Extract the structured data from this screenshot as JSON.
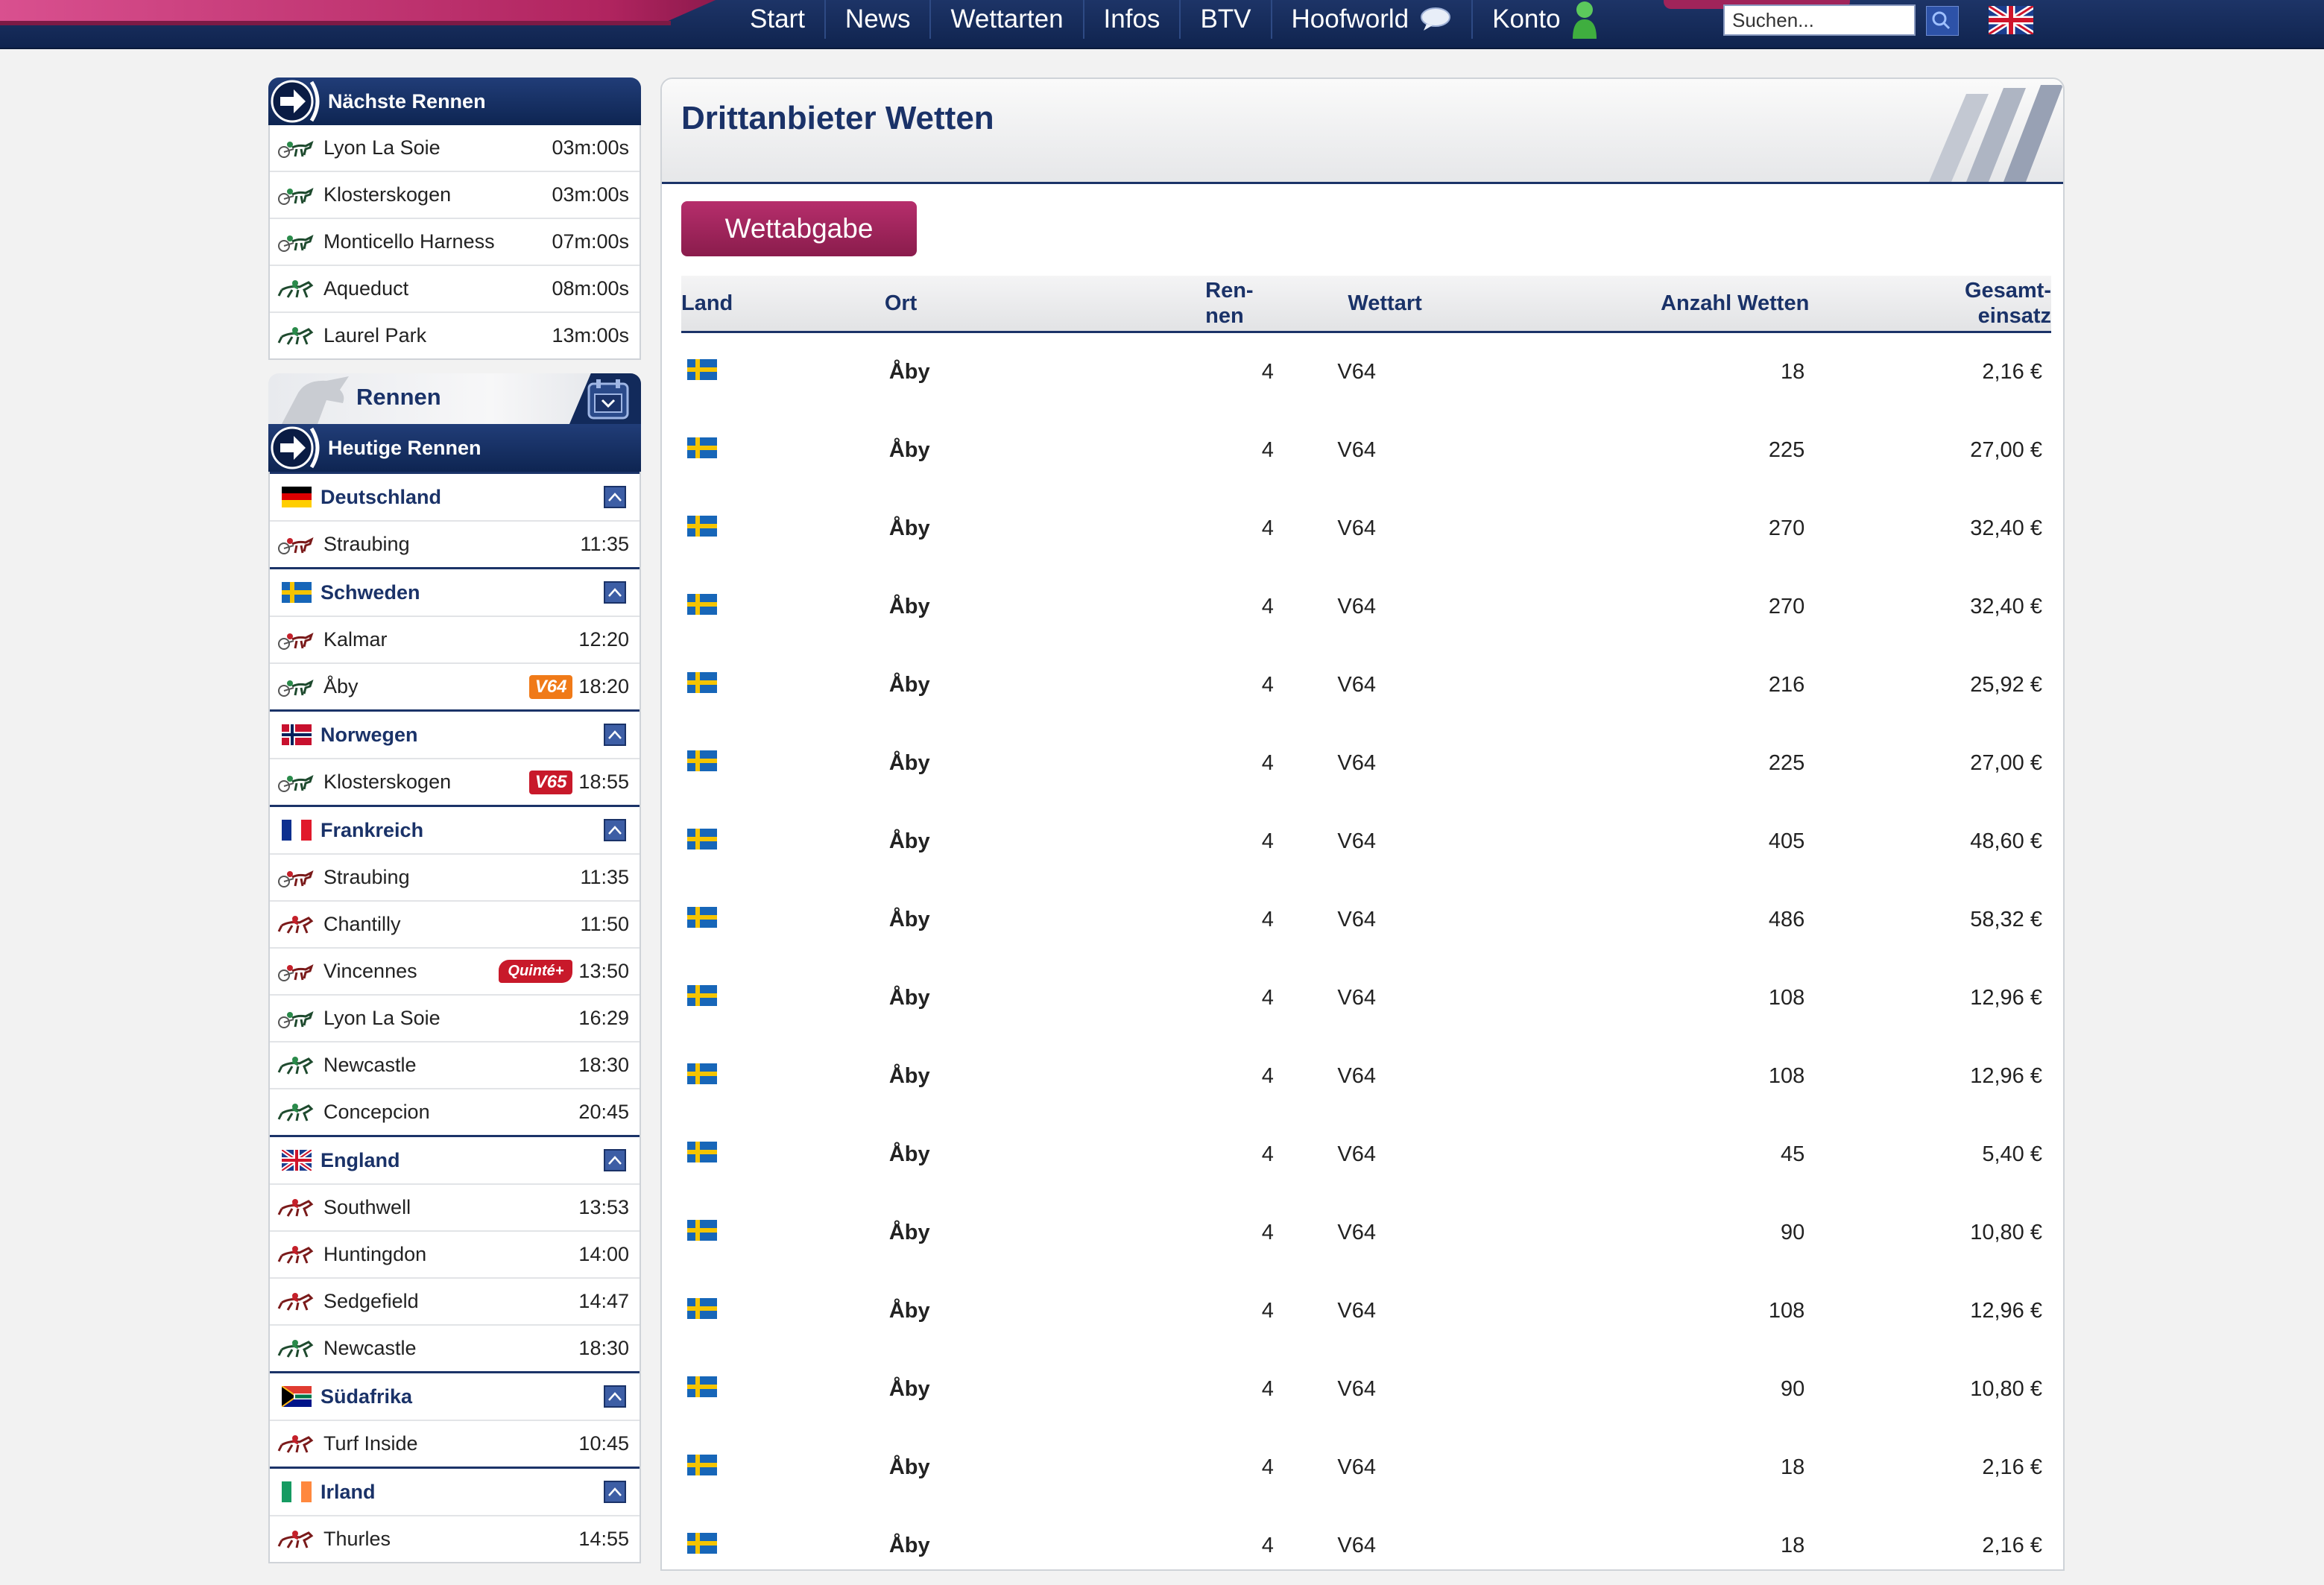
{
  "nav": {
    "items": [
      "Start",
      "News",
      "Wettarten",
      "Infos",
      "BTV",
      "Hoofworld",
      "Konto"
    ],
    "search_placeholder": "Suchen...",
    "icons": {
      "hoofworld": "chat-bubble-icon",
      "konto": "user-icon",
      "language": "uk-flag-icon"
    }
  },
  "sidebar": {
    "next_title": "Nächste Rennen",
    "next_races": [
      {
        "name": "Lyon La Soie",
        "time": "03m:00s",
        "horse": "trotter"
      },
      {
        "name": "Klosterskogen",
        "time": "03m:00s",
        "horse": "trotter"
      },
      {
        "name": "Monticello Harness",
        "time": "07m:00s",
        "horse": "trotter"
      },
      {
        "name": "Aqueduct",
        "time": "08m:00s",
        "horse": "gallop"
      },
      {
        "name": "Laurel Park",
        "time": "13m:00s",
        "horse": "gallop"
      }
    ],
    "rennen_title": "Rennen",
    "today_title": "Heutige Rennen",
    "countries": [
      {
        "name": "Deutschland",
        "flag": "de",
        "races": [
          {
            "name": "Straubing",
            "time": "11:35",
            "horse": "trotter-red"
          }
        ]
      },
      {
        "name": "Schweden",
        "flag": "se",
        "races": [
          {
            "name": "Kalmar",
            "time": "12:20",
            "horse": "trotter-red"
          },
          {
            "name": "Åby",
            "time": "18:20",
            "horse": "trotter",
            "badge": "V64"
          }
        ]
      },
      {
        "name": "Norwegen",
        "flag": "no",
        "races": [
          {
            "name": "Klosterskogen",
            "time": "18:55",
            "horse": "trotter",
            "badge": "V65"
          }
        ]
      },
      {
        "name": "Frankreich",
        "flag": "fr",
        "races": [
          {
            "name": "Straubing",
            "time": "11:35",
            "horse": "trotter-red"
          },
          {
            "name": "Chantilly",
            "time": "11:50",
            "horse": "gallop-red"
          },
          {
            "name": "Vincennes",
            "time": "13:50",
            "horse": "trotter-red",
            "badge": "Quinté+"
          },
          {
            "name": "Lyon La Soie",
            "time": "16:29",
            "horse": "trotter"
          },
          {
            "name": "Newcastle",
            "time": "18:30",
            "horse": "gallop"
          },
          {
            "name": "Concepcion",
            "time": "20:45",
            "horse": "gallop"
          }
        ]
      },
      {
        "name": "England",
        "flag": "gb",
        "races": [
          {
            "name": "Southwell",
            "time": "13:53",
            "horse": "gallop-red"
          },
          {
            "name": "Huntingdon",
            "time": "14:00",
            "horse": "gallop-red"
          },
          {
            "name": "Sedgefield",
            "time": "14:47",
            "horse": "gallop-red"
          },
          {
            "name": "Newcastle",
            "time": "18:30",
            "horse": "gallop"
          }
        ]
      },
      {
        "name": "Südafrika",
        "flag": "za",
        "races": [
          {
            "name": "Turf Inside",
            "time": "10:45",
            "horse": "gallop-red"
          }
        ]
      },
      {
        "name": "Irland",
        "flag": "ie",
        "races": [
          {
            "name": "Thurles",
            "time": "14:55",
            "horse": "gallop-red"
          }
        ]
      }
    ]
  },
  "main": {
    "title": "Drittanbieter Wetten",
    "button_label": "Wettabgabe",
    "columns": {
      "land": "Land",
      "ort": "Ort",
      "rennen_1": "Ren-",
      "rennen_2": "nen",
      "wettart": "Wettart",
      "anzahl": "Anzahl Wetten",
      "gesamt_1": "Gesamt-",
      "gesamt_2": "einsatz"
    },
    "rows": [
      {
        "land": "se",
        "ort": "Åby",
        "rennen": "4",
        "wettart": "V64",
        "anzahl": "18",
        "gesamt": "2,16 €"
      },
      {
        "land": "se",
        "ort": "Åby",
        "rennen": "4",
        "wettart": "V64",
        "anzahl": "225",
        "gesamt": "27,00 €"
      },
      {
        "land": "se",
        "ort": "Åby",
        "rennen": "4",
        "wettart": "V64",
        "anzahl": "270",
        "gesamt": "32,40 €"
      },
      {
        "land": "se",
        "ort": "Åby",
        "rennen": "4",
        "wettart": "V64",
        "anzahl": "270",
        "gesamt": "32,40 €"
      },
      {
        "land": "se",
        "ort": "Åby",
        "rennen": "4",
        "wettart": "V64",
        "anzahl": "216",
        "gesamt": "25,92 €"
      },
      {
        "land": "se",
        "ort": "Åby",
        "rennen": "4",
        "wettart": "V64",
        "anzahl": "225",
        "gesamt": "27,00 €"
      },
      {
        "land": "se",
        "ort": "Åby",
        "rennen": "4",
        "wettart": "V64",
        "anzahl": "405",
        "gesamt": "48,60 €"
      },
      {
        "land": "se",
        "ort": "Åby",
        "rennen": "4",
        "wettart": "V64",
        "anzahl": "486",
        "gesamt": "58,32 €"
      },
      {
        "land": "se",
        "ort": "Åby",
        "rennen": "4",
        "wettart": "V64",
        "anzahl": "108",
        "gesamt": "12,96 €"
      },
      {
        "land": "se",
        "ort": "Åby",
        "rennen": "4",
        "wettart": "V64",
        "anzahl": "108",
        "gesamt": "12,96 €"
      },
      {
        "land": "se",
        "ort": "Åby",
        "rennen": "4",
        "wettart": "V64",
        "anzahl": "45",
        "gesamt": "5,40 €"
      },
      {
        "land": "se",
        "ort": "Åby",
        "rennen": "4",
        "wettart": "V64",
        "anzahl": "90",
        "gesamt": "10,80 €"
      },
      {
        "land": "se",
        "ort": "Åby",
        "rennen": "4",
        "wettart": "V64",
        "anzahl": "108",
        "gesamt": "12,96 €"
      },
      {
        "land": "se",
        "ort": "Åby",
        "rennen": "4",
        "wettart": "V64",
        "anzahl": "90",
        "gesamt": "10,80 €"
      },
      {
        "land": "se",
        "ort": "Åby",
        "rennen": "4",
        "wettart": "V64",
        "anzahl": "18",
        "gesamt": "2,16 €"
      },
      {
        "land": "se",
        "ort": "Åby",
        "rennen": "4",
        "wettart": "V64",
        "anzahl": "18",
        "gesamt": "2,16 €"
      }
    ]
  },
  "colors": {
    "navy": "#1a3268",
    "accent": "#a0245a",
    "v64": "#f07a18",
    "v65": "#c8192a"
  }
}
